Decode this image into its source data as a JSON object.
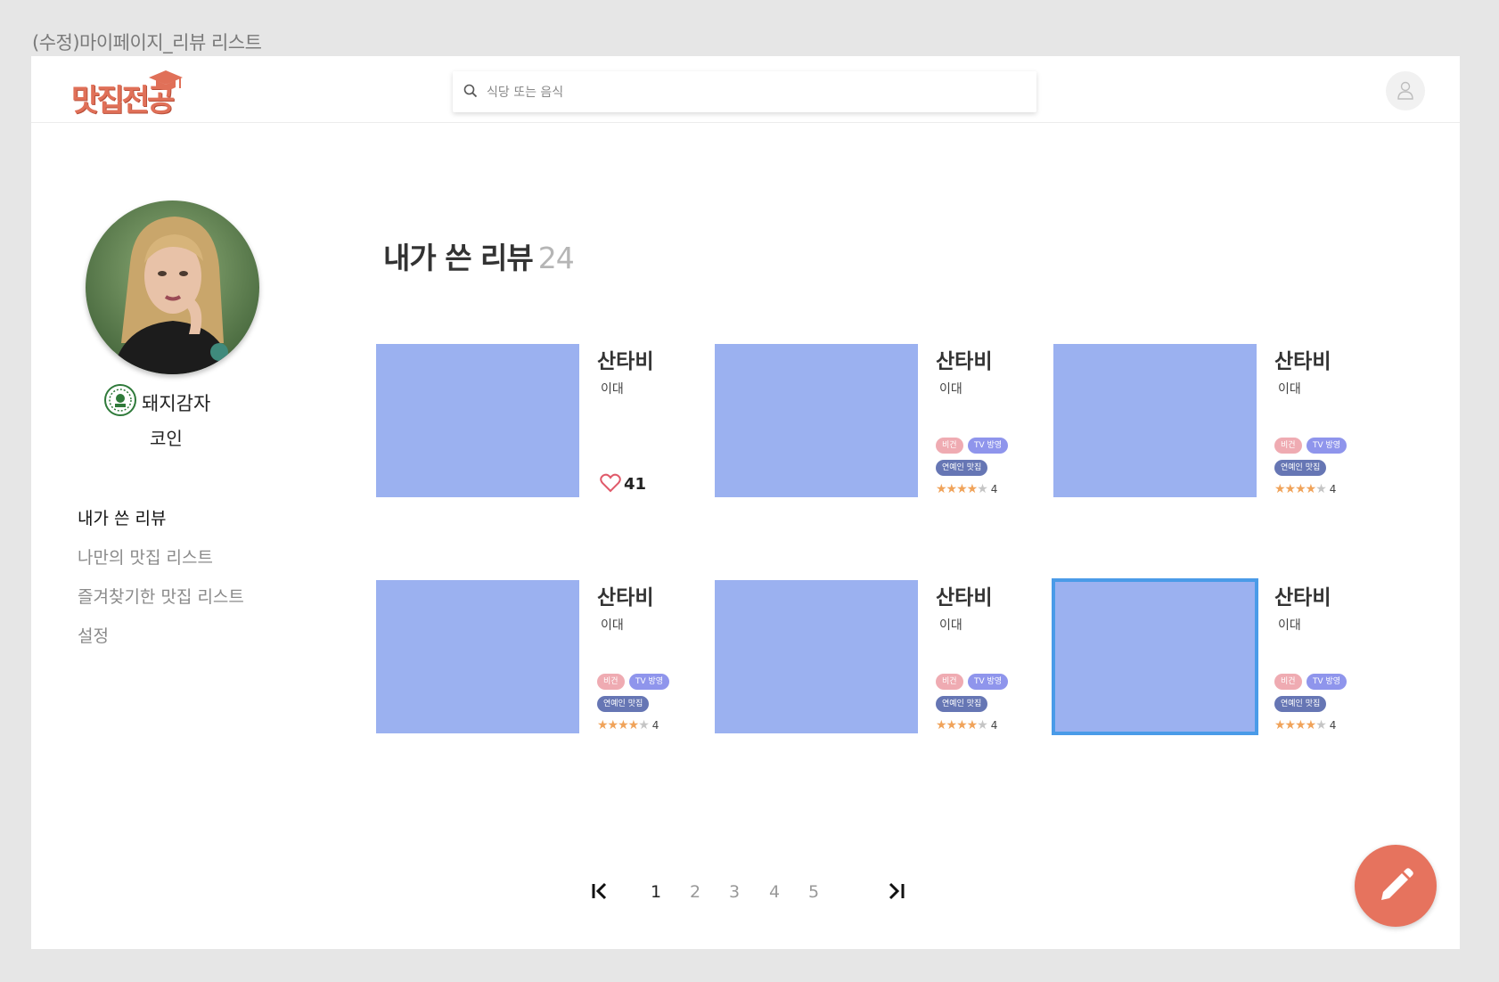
{
  "frame": {
    "title": "(수정)마이페이지_리뷰 리스트"
  },
  "header": {
    "logo_text": "맛집전공",
    "search": {
      "placeholder": "식당 또는 음식",
      "value": ""
    }
  },
  "profile": {
    "nickname": "돼지감자",
    "level": "코인"
  },
  "sidebar": {
    "items": [
      {
        "label": "내가 쓴 리뷰",
        "active": true
      },
      {
        "label": "나만의 맛집 리스트",
        "active": false
      },
      {
        "label": "즐겨찾기한 맛집 리스트",
        "active": false
      },
      {
        "label": "설정",
        "active": false
      }
    ]
  },
  "main": {
    "title": "내가 쓴 리뷰",
    "count": "24",
    "cards": [
      {
        "name": "산타비",
        "location": "이대",
        "likes": "41"
      },
      {
        "name": "산타비",
        "location": "이대",
        "tags": [
          "비건",
          "TV 방영",
          "연예인 맛집"
        ],
        "rating": 4,
        "score": "4"
      },
      {
        "name": "산타비",
        "location": "이대",
        "tags": [
          "비건",
          "TV 방영",
          "연예인 맛집"
        ],
        "rating": 4,
        "score": "4"
      },
      {
        "name": "산타비",
        "location": "이대",
        "tags": [
          "비건",
          "TV 방영",
          "연예인 맛집"
        ],
        "rating": 4,
        "score": "4"
      },
      {
        "name": "산타비",
        "location": "이대",
        "tags": [
          "비건",
          "TV 방영",
          "연예인 맛집"
        ],
        "rating": 4,
        "score": "4"
      },
      {
        "name": "산타비",
        "location": "이대",
        "tags": [
          "비건",
          "TV 방영",
          "연예인 맛집"
        ],
        "rating": 4,
        "score": "4",
        "selected": true
      }
    ]
  },
  "pagination": {
    "first_icon": "first-page-icon",
    "last_icon": "last-page-icon",
    "pages": [
      "1",
      "2",
      "3",
      "4",
      "5"
    ],
    "current": "1"
  },
  "fab": {
    "icon": "pencil-icon"
  },
  "colors": {
    "brand": "#e07058",
    "thumbnail": "#9bb1f0",
    "tag_vegan": "#efabb2",
    "tag_tv": "#8f95ec",
    "tag_celeb": "#6676b4",
    "star": "#f0a35a",
    "fab": "#e6735e",
    "selected_outline": "#4a9be8"
  }
}
